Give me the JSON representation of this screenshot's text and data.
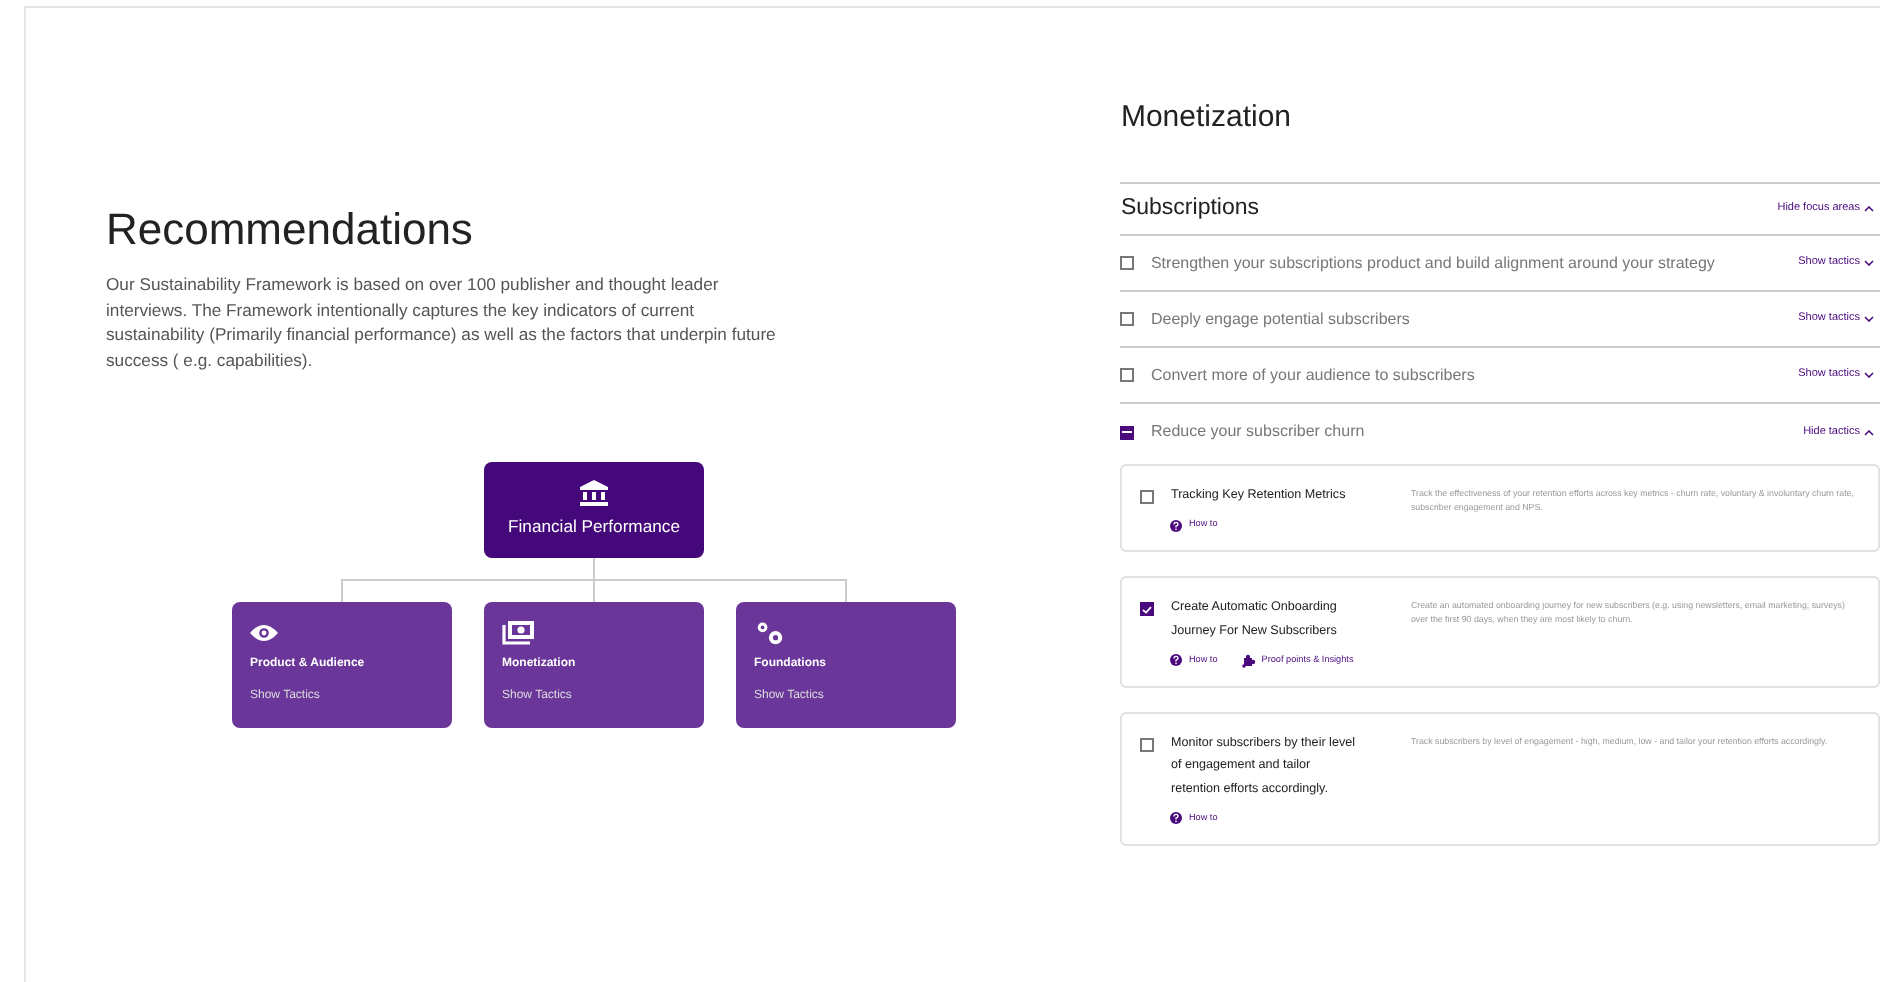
{
  "recommendations": {
    "title": "Recommendations",
    "description": "Our Sustainability Framework is based on over 100 publisher and thought leader interviews. The Framework intentionally captures the key indicators of current sustainability (Primarily financial performance) as well as the factors that underpin future success ( e.g. capabilities)."
  },
  "tree": {
    "root": {
      "kind": "bank",
      "label": "Financial Performance"
    },
    "children": [
      {
        "kind": "eye",
        "label": "Product & Audience",
        "action": "Show Tactics"
      },
      {
        "kind": "money",
        "label": "Monetization",
        "action": "Show Tactics"
      },
      {
        "kind": "gears",
        "label": "Foundations",
        "action": "Show Tactics"
      }
    ]
  },
  "panel": {
    "title": "Monetization",
    "section": {
      "title": "Subscriptions",
      "toggle": "Hide focus areas",
      "expanded": true
    },
    "focus_areas": [
      {
        "label": "Strengthen your subscriptions product and build alignment around your strategy",
        "toggle": "Show tactics",
        "checked": false,
        "indeterminate": false,
        "expanded": false
      },
      {
        "label": "Deeply engage potential subscribers",
        "toggle": "Show tactics",
        "checked": false,
        "indeterminate": false,
        "expanded": false
      },
      {
        "label": "Convert more of your audience to subscribers",
        "toggle": "Show tactics",
        "checked": false,
        "indeterminate": false,
        "expanded": false
      },
      {
        "label": "Reduce your subscriber churn",
        "toggle": "Hide tactics",
        "checked": false,
        "indeterminate": true,
        "expanded": true
      }
    ],
    "tactics": [
      {
        "title": "Tracking Key Retention Metrics",
        "description": "Track the effectiveness of your retention efforts across key metrics - churn rate, voluntary & involuntary churn rate, subscriber engagement and NPS.",
        "checked": false,
        "links": [
          {
            "kind": "help",
            "label": "How to"
          }
        ]
      },
      {
        "title": "Create Automatic Onboarding Journey For New Subscribers",
        "description": "Create an automated onboarding journey for new subscribers (e.g. using newsletters, email marketing, surveys) over the first 90 days, when they are most likely to churn.",
        "checked": true,
        "links": [
          {
            "kind": "help",
            "label": "How to"
          },
          {
            "kind": "puzzle",
            "label": "Proof points & Insights"
          }
        ]
      },
      {
        "title": "Monitor subscribers by their level of engagement and tailor retention efforts accordingly.",
        "description": "Track subscribers by level of engagement - high, medium, low - and tailor your retention efforts accordingly.",
        "checked": false,
        "links": [
          {
            "kind": "help",
            "label": "How to"
          }
        ]
      }
    ]
  }
}
